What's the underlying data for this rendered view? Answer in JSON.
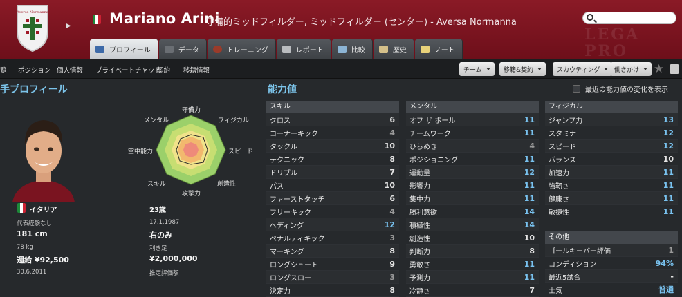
{
  "header": {
    "club_badge_text": "Aversa Normanna",
    "player_name": "Mariano Arini",
    "positions_club": "守備的ミッドフィルダー, ミッドフィルダー (センター) - Aversa Normanna",
    "bg_watermark_1": "LEGA",
    "bg_watermark_2": "PRO",
    "flag_colors": [
      "#1e8a3a",
      "#ffffff",
      "#cc2233"
    ]
  },
  "tabs": [
    {
      "label": "プロフィール",
      "icon": "profile-icon",
      "active": true
    },
    {
      "label": "データ",
      "icon": "stats-icon",
      "active": false
    },
    {
      "label": "トレーニング",
      "icon": "training-icon",
      "active": false
    },
    {
      "label": "レポート",
      "icon": "report-icon",
      "active": false
    },
    {
      "label": "比較",
      "icon": "compare-icon",
      "active": false
    },
    {
      "label": "歴史",
      "icon": "history-icon",
      "active": false
    },
    {
      "label": "ノート",
      "icon": "notes-icon",
      "active": false
    }
  ],
  "subnav": {
    "items": [
      "覧",
      "ポジション",
      "個人情報",
      "プライベートチャット",
      "契約",
      "移籍情報"
    ],
    "dropdowns": [
      "チーム",
      "移籍&契約",
      "スカウティング",
      "働きかけ"
    ]
  },
  "profile": {
    "title": "手プロフィール",
    "radar_labels": [
      "守備力",
      "フィジカル",
      "スピード",
      "創造性",
      "攻撃力",
      "スキル",
      "空中能力",
      "メンタル"
    ]
  },
  "info": {
    "nation": "イタリア",
    "age": "23歳",
    "caps": "代表経験なし",
    "dob": "17.1.1987",
    "height": "181 cm",
    "foot": "右のみ",
    "weight": "78 kg",
    "foot_label": "利き足",
    "wage": "週給 ¥92,500",
    "value": "¥2,000,000",
    "contract_end": "30.6.2011",
    "value_label": "推定評価額"
  },
  "ability": {
    "title": "能力値",
    "show_changes_label": "最近の能力値の変化を表示",
    "skills_head": "スキル",
    "skills": [
      {
        "name": "クロス",
        "value": "6"
      },
      {
        "name": "コーナーキック",
        "value": "4"
      },
      {
        "name": "タックル",
        "value": "10"
      },
      {
        "name": "テクニック",
        "value": "8"
      },
      {
        "name": "ドリブル",
        "value": "7"
      },
      {
        "name": "パス",
        "value": "10"
      },
      {
        "name": "ファーストタッチ",
        "value": "6"
      },
      {
        "name": "フリーキック",
        "value": "4"
      },
      {
        "name": "ヘディング",
        "value": "12"
      },
      {
        "name": "ペナルティキック",
        "value": "3"
      },
      {
        "name": "マーキング",
        "value": "8"
      },
      {
        "name": "ロングシュート",
        "value": "9"
      },
      {
        "name": "ロングスロー",
        "value": "3"
      },
      {
        "name": "決定力",
        "value": "8"
      }
    ],
    "mental_head": "メンタル",
    "mental": [
      {
        "name": "オフ ザ ボール",
        "value": "11"
      },
      {
        "name": "チームワーク",
        "value": "11"
      },
      {
        "name": "ひらめき",
        "value": "4"
      },
      {
        "name": "ポジショニング",
        "value": "11"
      },
      {
        "name": "運動量",
        "value": "12"
      },
      {
        "name": "影響力",
        "value": "11"
      },
      {
        "name": "集中力",
        "value": "11"
      },
      {
        "name": "勝利意欲",
        "value": "14"
      },
      {
        "name": "積極性",
        "value": "14"
      },
      {
        "name": "創造性",
        "value": "10"
      },
      {
        "name": "判断力",
        "value": "8"
      },
      {
        "name": "勇敢さ",
        "value": "11"
      },
      {
        "name": "予測力",
        "value": "11"
      },
      {
        "name": "冷静さ",
        "value": "7"
      }
    ],
    "physical_head": "フィジカル",
    "physical": [
      {
        "name": "ジャンプ力",
        "value": "13"
      },
      {
        "name": "スタミナ",
        "value": "12"
      },
      {
        "name": "スピード",
        "value": "12"
      },
      {
        "name": "バランス",
        "value": "10"
      },
      {
        "name": "加速力",
        "value": "11"
      },
      {
        "name": "強靭さ",
        "value": "11"
      },
      {
        "name": "健康さ",
        "value": "11"
      },
      {
        "name": "敏捷性",
        "value": "11"
      }
    ],
    "other_head": "その他",
    "other": [
      {
        "name": "ゴールキーパー評価",
        "value": "1"
      },
      {
        "name": "コンディション",
        "value": "94%"
      },
      {
        "name": "最近5試合",
        "value": "-"
      },
      {
        "name": "士気",
        "value": "普通"
      }
    ]
  },
  "colors": {
    "accent": "#7cc4ea",
    "header_red": "#7a1420"
  }
}
